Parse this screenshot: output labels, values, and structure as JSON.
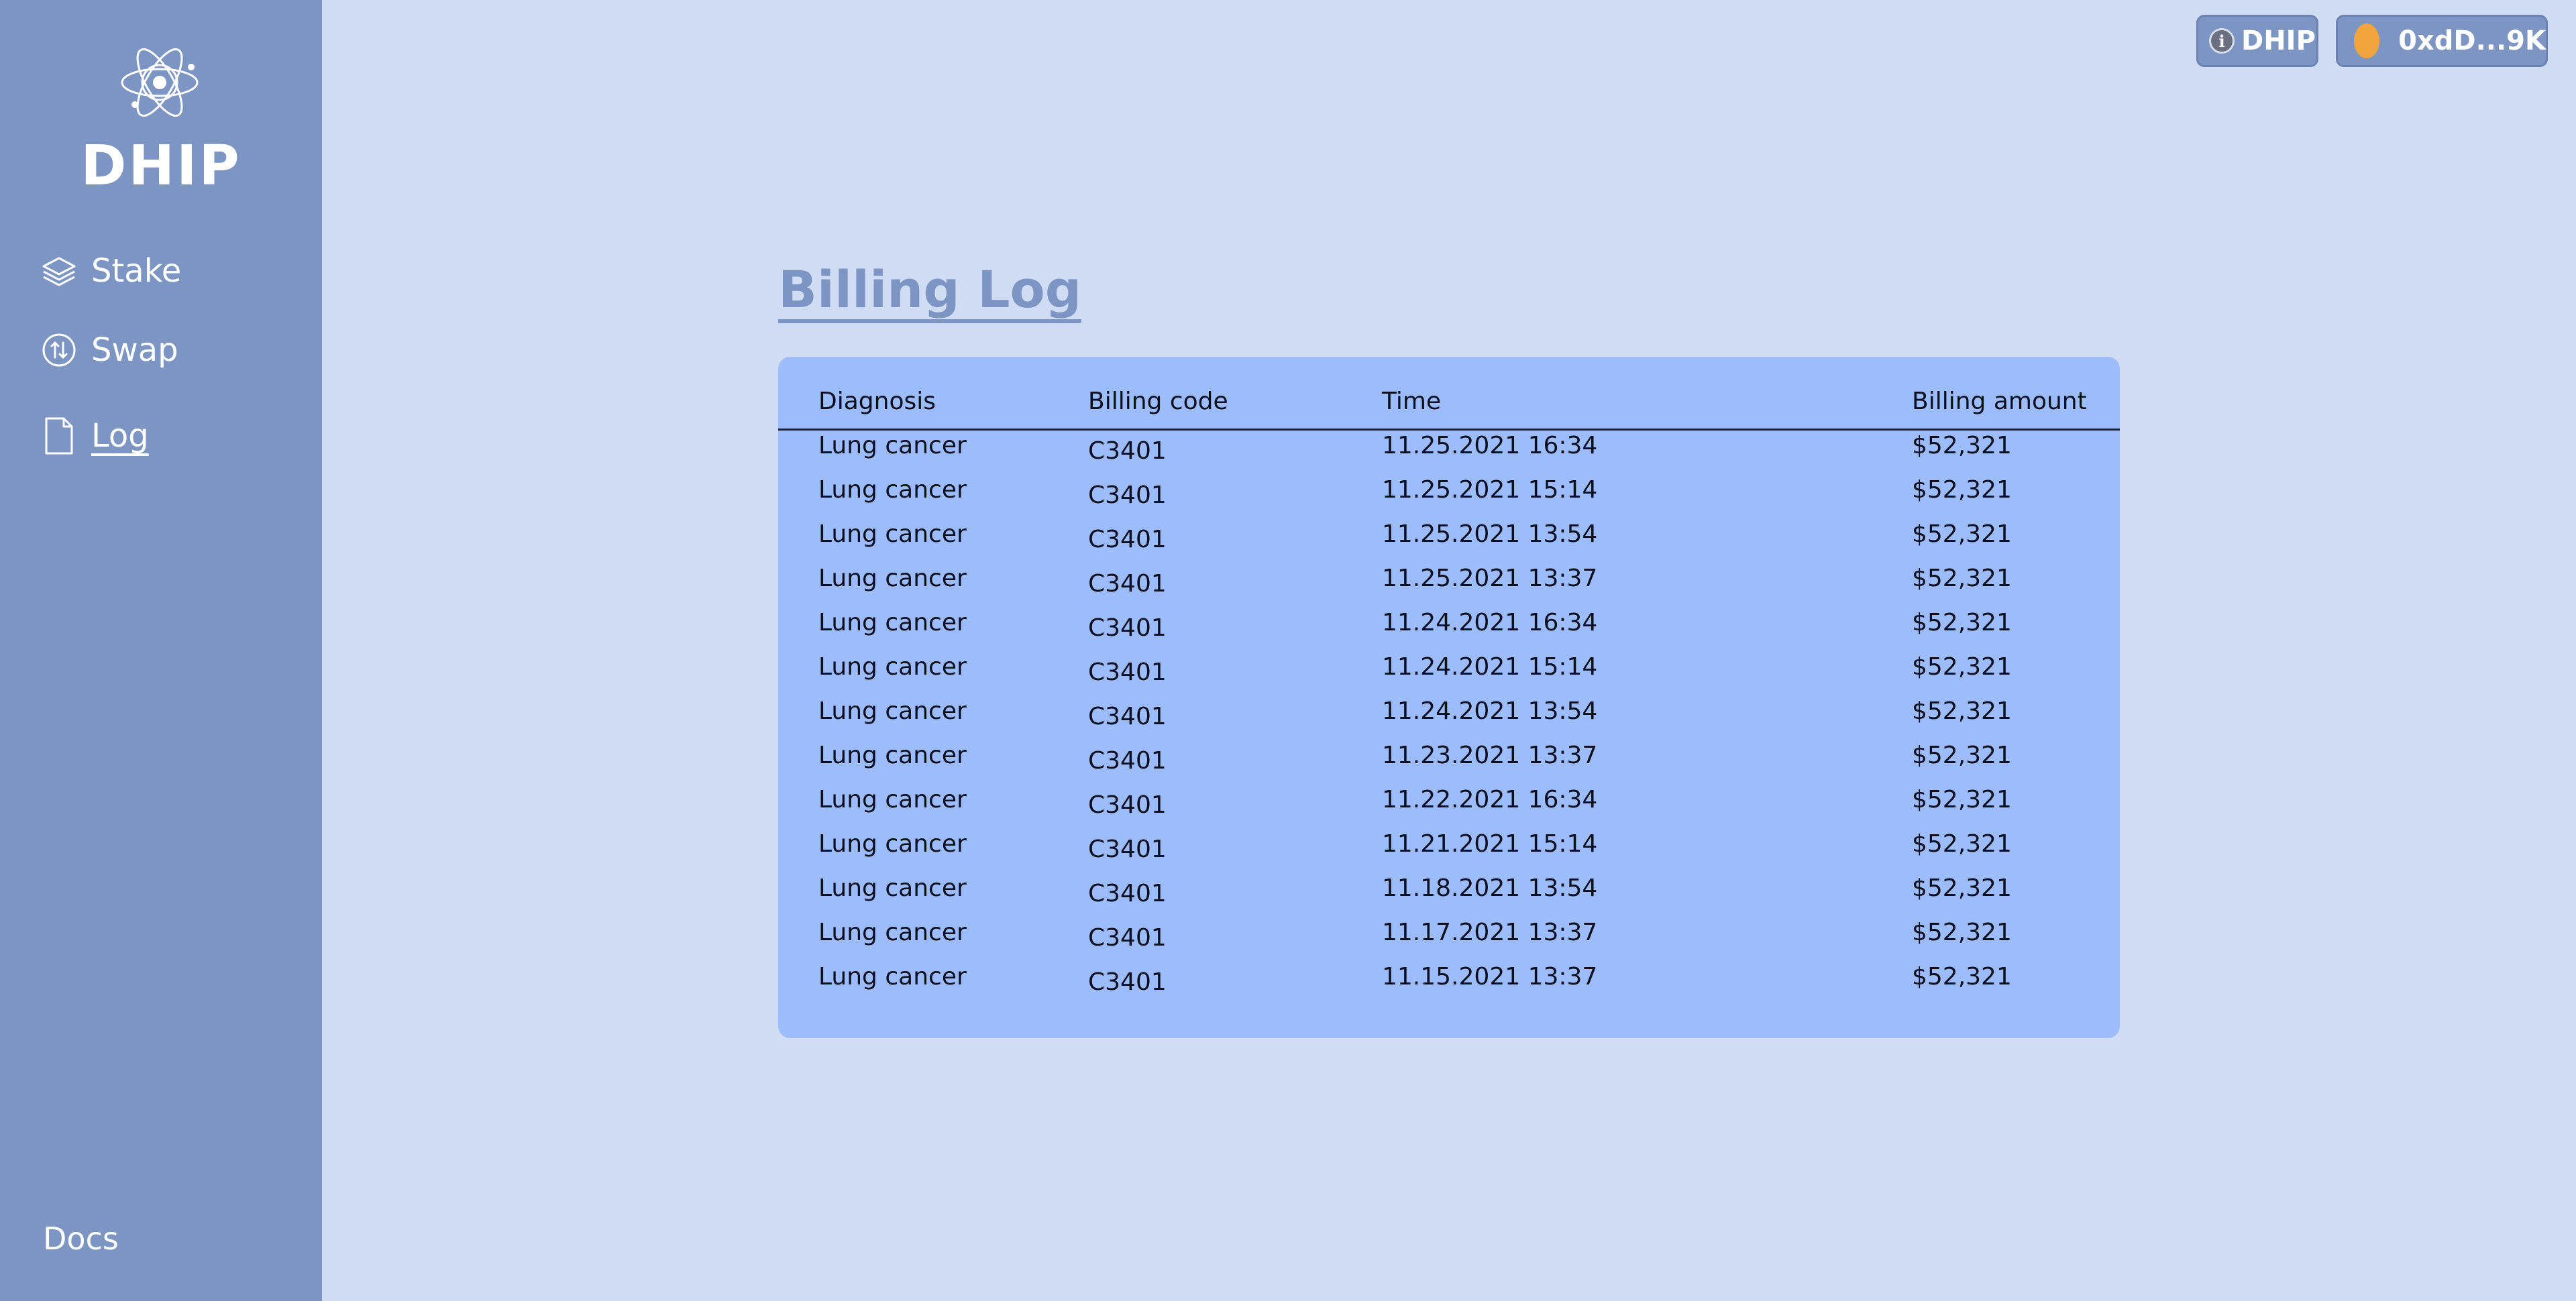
{
  "brand": {
    "name": "DHIP",
    "logo_icon": "atom-icon"
  },
  "sidebar": {
    "items": [
      {
        "label": "Stake",
        "icon": "layers-icon"
      },
      {
        "label": "Swap",
        "icon": "swap-arrows-icon"
      },
      {
        "label": "Log",
        "icon": "document-icon",
        "active": true
      }
    ],
    "docs_label": "Docs"
  },
  "topbar": {
    "token_label": "DHIP",
    "token_icon": "info-icon",
    "wallet_label": "0xdD...9K",
    "wallet_icon": "coin-icon"
  },
  "main": {
    "title": "Billing Log",
    "table": {
      "headers": [
        "Diagnosis",
        "Billing code",
        "Time",
        "Billing amount"
      ],
      "rows": [
        {
          "diagnosis": "Lung cancer",
          "code": "C3401",
          "time": "11.25.2021 16:34",
          "amount": "$52,321"
        },
        {
          "diagnosis": "Lung cancer",
          "code": "C3401",
          "time": "11.25.2021 15:14",
          "amount": "$52,321"
        },
        {
          "diagnosis": "Lung cancer",
          "code": "C3401",
          "time": "11.25.2021 13:54",
          "amount": "$52,321"
        },
        {
          "diagnosis": "Lung cancer",
          "code": "C3401",
          "time": "11.25.2021 13:37",
          "amount": "$52,321"
        },
        {
          "diagnosis": "Lung cancer",
          "code": "C3401",
          "time": "11.24.2021 16:34",
          "amount": "$52,321"
        },
        {
          "diagnosis": "Lung cancer",
          "code": "C3401",
          "time": "11.24.2021 15:14",
          "amount": "$52,321"
        },
        {
          "diagnosis": "Lung cancer",
          "code": "C3401",
          "time": "11.24.2021 13:54",
          "amount": "$52,321"
        },
        {
          "diagnosis": "Lung cancer",
          "code": "C3401",
          "time": "11.23.2021 13:37",
          "amount": "$52,321"
        },
        {
          "diagnosis": "Lung cancer",
          "code": "C3401",
          "time": "11.22.2021 16:34",
          "amount": "$52,321"
        },
        {
          "diagnosis": "Lung cancer",
          "code": "C3401",
          "time": "11.21.2021 15:14",
          "amount": "$52,321"
        },
        {
          "diagnosis": "Lung cancer",
          "code": "C3401",
          "time": "11.18.2021 13:54",
          "amount": "$52,321"
        },
        {
          "diagnosis": "Lung cancer",
          "code": "C3401",
          "time": "11.17.2021 13:37",
          "amount": "$52,321"
        },
        {
          "diagnosis": "Lung cancer",
          "code": "C3401",
          "time": "11.15.2021 13:37",
          "amount": "$52,321"
        }
      ]
    }
  },
  "colors": {
    "background": "#d0dcf3",
    "sidebar": "#7d95c3",
    "table": "#9dbcfb",
    "accent": "#7d95c3",
    "coin": "#f2a53f"
  }
}
